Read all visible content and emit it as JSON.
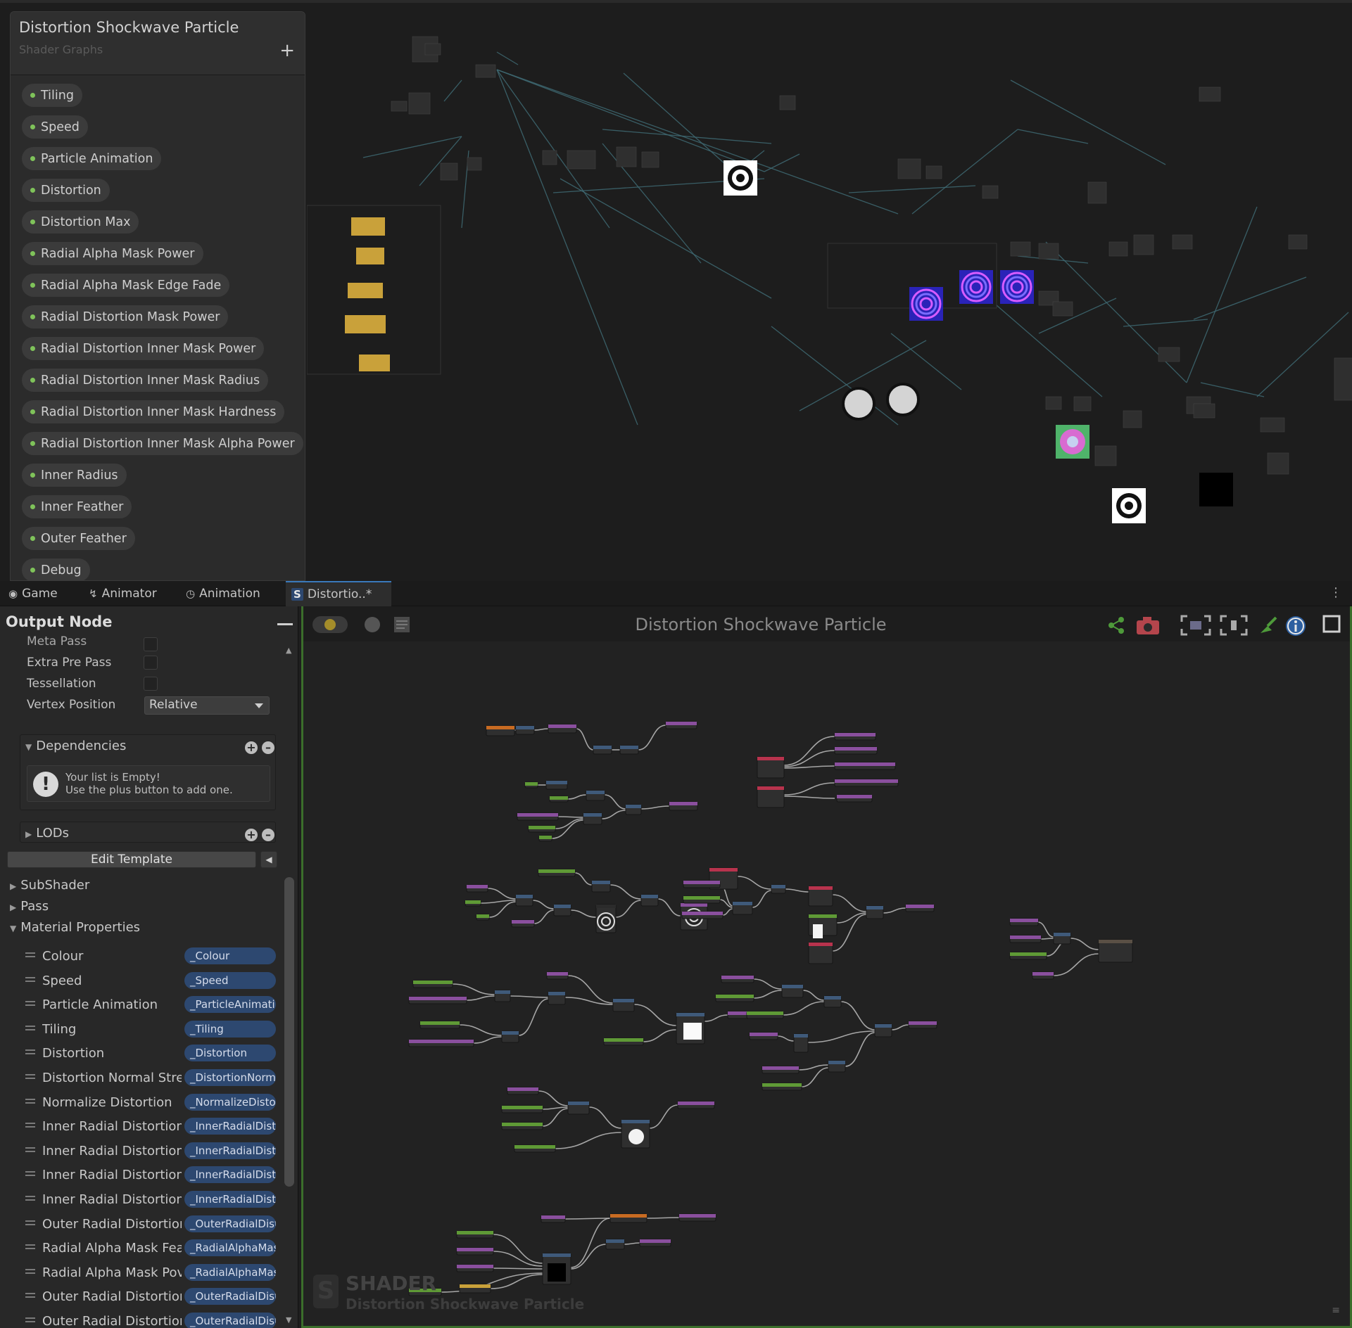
{
  "blackboard": {
    "title": "Distortion Shockwave Particle",
    "subtitle": "Shader Graphs",
    "add_symbol": "+",
    "properties": [
      "Tiling",
      "Speed",
      "Particle Animation",
      "Distortion",
      "Distortion Max",
      "Radial Alpha Mask Power",
      "Radial Alpha Mask Edge Fade",
      "Radial Distortion Mask Power",
      "Radial Distortion Inner Mask Power",
      "Radial Distortion Inner Mask Radius",
      "Radial Distortion Inner Mask Hardness",
      "Radial Distortion Inner Mask Alpha Power",
      "Inner Radius",
      "Inner Feather",
      "Outer Feather",
      "Debug"
    ]
  },
  "tabs": [
    {
      "label": "Game",
      "icon": "gamepad-icon"
    },
    {
      "label": "Animator",
      "icon": "animator-icon"
    },
    {
      "label": "Animation",
      "icon": "clock-icon"
    },
    {
      "label": "Distortio..*",
      "icon": "shader-icon"
    }
  ],
  "inspector": {
    "title": "Output Node",
    "fields": {
      "meta_pass": "Meta Pass",
      "extra_pre_pass": "Extra Pre Pass",
      "tessellation": "Tessellation",
      "vertex_position": "Vertex Position",
      "vertex_position_value": "Relative"
    },
    "dependencies": {
      "label": "Dependencies",
      "empty_line1": "Your list is Empty!",
      "empty_line2": "Use the plus button to add one."
    },
    "lods_label": "LODs",
    "edit_template": "Edit Template",
    "folds": {
      "subshader": "SubShader",
      "pass": "Pass",
      "material_properties": "Material Properties"
    },
    "material_properties": [
      {
        "name": "Colour",
        "ref": "_Colour"
      },
      {
        "name": "Speed",
        "ref": "_Speed"
      },
      {
        "name": "Particle Animation",
        "ref": "_ParticleAnimati"
      },
      {
        "name": "Tiling",
        "ref": "_Tiling"
      },
      {
        "name": "Distortion",
        "ref": "_Distortion"
      },
      {
        "name": "Distortion Normal Strer",
        "ref": "_DistortionNorm"
      },
      {
        "name": "Normalize Distortion",
        "ref": "_NormalizeDisto"
      },
      {
        "name": "Inner Radial Distortion",
        "ref": "_InnerRadialDist"
      },
      {
        "name": "Inner Radial Distortion",
        "ref": "_InnerRadialDist"
      },
      {
        "name": "Inner Radial Distortion",
        "ref": "_InnerRadialDist"
      },
      {
        "name": "Inner Radial Distortion",
        "ref": "_InnerRadialDist"
      },
      {
        "name": "Outer Radial Distortion",
        "ref": "_OuterRadialDist"
      },
      {
        "name": "Radial Alpha Mask Fea",
        "ref": "_RadialAlphaMas"
      },
      {
        "name": "Radial Alpha Mask Pov",
        "ref": "_RadialAlphaMas"
      },
      {
        "name": "Outer Radial Distortion",
        "ref": "_OuterRadialDist"
      },
      {
        "name": "Outer Radial Distortion",
        "ref": "_OuterRadialDist"
      }
    ]
  },
  "graph": {
    "title": "Distortion Shockwave Particle",
    "watermark_word": "SHADER",
    "watermark_name": "Distortion Shockwave Particle",
    "accent_border": "#3b6e2b"
  },
  "colors": {
    "node_purple": "#8a4f9e",
    "node_green": "#5f9a36",
    "node_red": "#b8334d",
    "node_orange": "#c86b22",
    "node_yellow": "#c9a13a",
    "node_blue": "#3f5a7a",
    "wire": "#bdbdbd",
    "mini_wire": "#3f6a73"
  }
}
